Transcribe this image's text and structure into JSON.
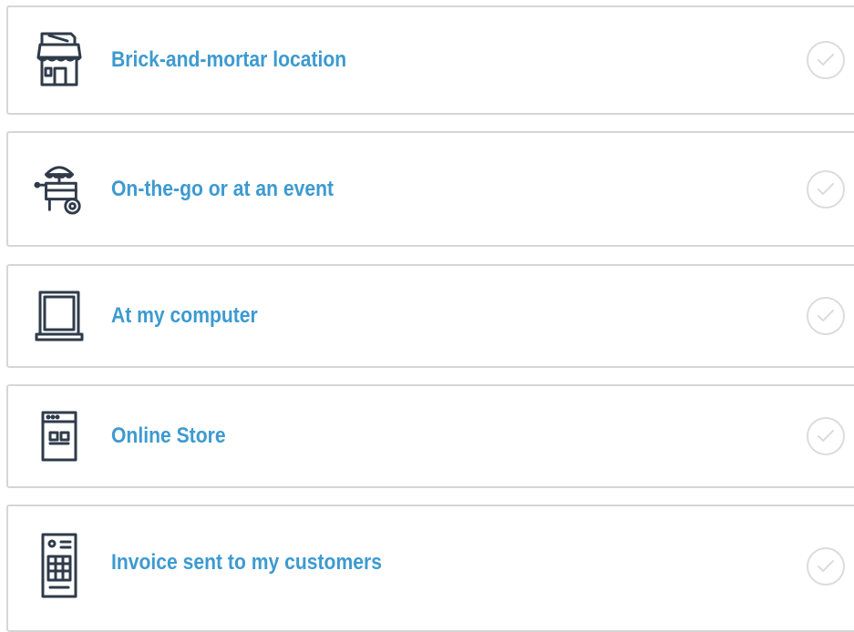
{
  "options": [
    {
      "label": "Brick-and-mortar location",
      "icon": "storefront-icon",
      "selected": false
    },
    {
      "label": "On-the-go or at an event",
      "icon": "food-cart-icon",
      "selected": false
    },
    {
      "label": "At my computer",
      "icon": "laptop-icon",
      "selected": false
    },
    {
      "label": "Online Store",
      "icon": "browser-window-icon",
      "selected": false
    },
    {
      "label": "Invoice sent to my customers",
      "icon": "invoice-document-icon",
      "selected": false
    }
  ],
  "colors": {
    "label": "#3d9ad1",
    "icon": "#2f3b4a",
    "border": "#d4d6d8",
    "check": "#dcdcdc"
  }
}
